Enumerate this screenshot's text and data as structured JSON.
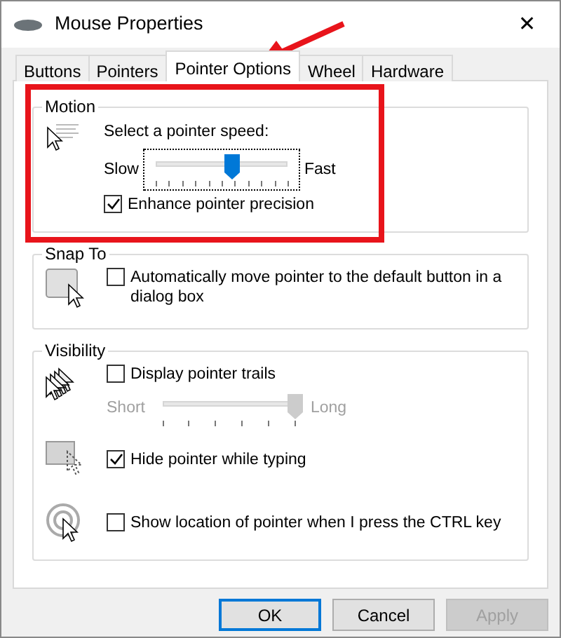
{
  "window": {
    "title": "Mouse Properties",
    "close": "✕"
  },
  "tabs": [
    {
      "label": "Buttons",
      "selected": false
    },
    {
      "label": "Pointers",
      "selected": false
    },
    {
      "label": "Pointer Options",
      "selected": true
    },
    {
      "label": "Wheel",
      "selected": false
    },
    {
      "label": "Hardware",
      "selected": false
    }
  ],
  "motion": {
    "title": "Motion",
    "speed_label": "Select a pointer speed:",
    "slow": "Slow",
    "fast": "Fast",
    "speed": {
      "level": 0.58
    },
    "enhance": {
      "label": "Enhance pointer precision",
      "checked": true
    }
  },
  "snap_to": {
    "title": "Snap To",
    "option": {
      "label": "Automatically move pointer to the default button in a dialog box",
      "checked": false
    }
  },
  "visibility": {
    "title": "Visibility",
    "trails": {
      "label": "Display pointer trails",
      "checked": false
    },
    "short": "Short",
    "long": "Long",
    "trail_length": {
      "level": 1,
      "disabled": true
    },
    "hide": {
      "label": "Hide pointer while typing",
      "checked": true
    },
    "show_location": {
      "label": "Show location of pointer when I press the CTRL key",
      "checked": false
    }
  },
  "buttons": [
    {
      "label": "OK",
      "default": true,
      "disabled": false
    },
    {
      "label": "Cancel",
      "default": false,
      "disabled": false
    },
    {
      "label": "Apply",
      "default": false,
      "disabled": true
    }
  ]
}
